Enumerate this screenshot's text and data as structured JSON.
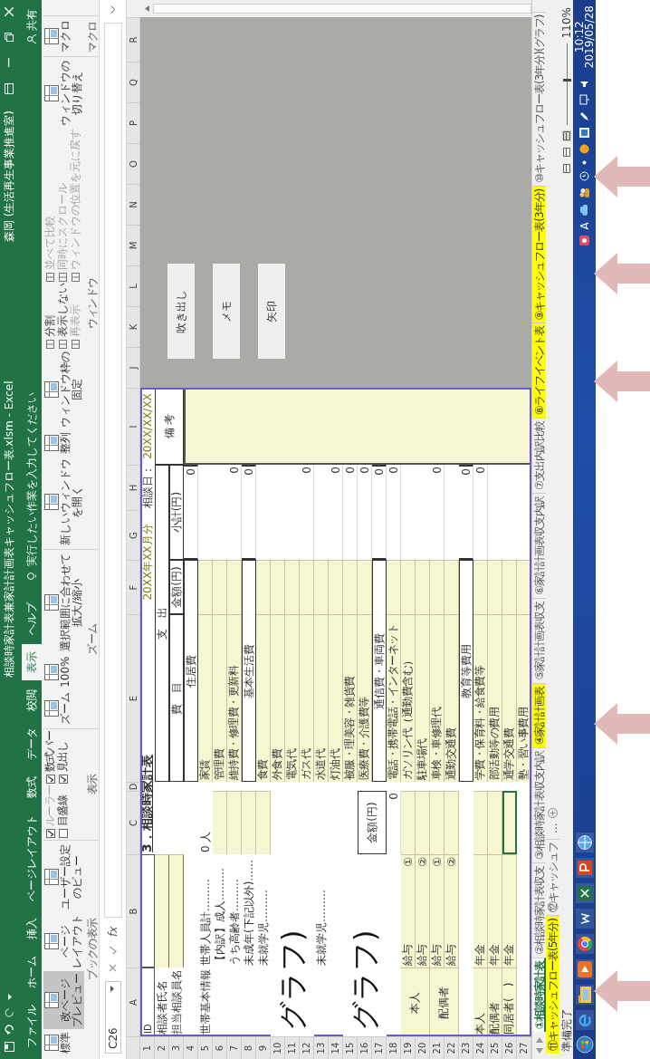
{
  "title_bar": {
    "title": "相談時家計表兼家計計画表キャッシュフロー表.xlsm - Excel",
    "user": "森岡 (生活再生事業推進室)"
  },
  "ribbon_tabs": [
    {
      "label": "ファイル",
      "selected": false
    },
    {
      "label": "ホーム",
      "selected": false
    },
    {
      "label": "挿入",
      "selected": false
    },
    {
      "label": "ページレイアウト",
      "selected": false
    },
    {
      "label": "数式",
      "selected": false
    },
    {
      "label": "データ",
      "selected": false
    },
    {
      "label": "校閲",
      "selected": false
    },
    {
      "label": "表示",
      "selected": true
    },
    {
      "label": "ヘルプ",
      "selected": false
    }
  ],
  "tell_me": {
    "placeholder": "実行したい作業を入力してください"
  },
  "share": "共有",
  "ribbon_groups": [
    {
      "name": "ブックの表示",
      "controls": [
        {
          "kind": "large",
          "lines": [
            "標準"
          ],
          "selected": false
        },
        {
          "kind": "large",
          "lines": [
            "改ページ",
            "プレビュー"
          ],
          "selected": true
        },
        {
          "kind": "large",
          "lines": [
            "ページ",
            "レイアウト"
          ],
          "selected": false
        },
        {
          "kind": "large",
          "lines": [
            "ユーザー設定",
            "のビュー"
          ],
          "selected": false
        }
      ]
    },
    {
      "name": "表示",
      "controls": [
        {
          "kind": "checkbox",
          "label": "ルーラー",
          "checked": true,
          "disabled": true
        },
        {
          "kind": "checkbox",
          "label": "目盛線",
          "checked": false,
          "disabled": false
        },
        {
          "kind": "checkbox",
          "label": "数式バー",
          "checked": true,
          "disabled": false
        },
        {
          "kind": "checkbox",
          "label": "見出し",
          "checked": true,
          "disabled": false
        }
      ]
    },
    {
      "name": "ズーム",
      "controls": [
        {
          "kind": "large",
          "lines": [
            "ズーム"
          ],
          "selected": false
        },
        {
          "kind": "large",
          "lines": [
            "100%"
          ],
          "selected": false
        },
        {
          "kind": "large",
          "lines": [
            "選択範囲に合わせて",
            "拡大/縮小"
          ],
          "selected": false
        }
      ]
    },
    {
      "name": "ウィンドウ",
      "controls": [
        {
          "kind": "large",
          "lines": [
            "新しいウィンドウ",
            "を開く"
          ],
          "selected": false
        },
        {
          "kind": "large",
          "lines": [
            "整列"
          ],
          "selected": false
        },
        {
          "kind": "large",
          "lines": [
            "ウィンドウ枠の",
            "固定"
          ],
          "selected": false
        },
        {
          "kind": "small",
          "label": "分割",
          "disabled": false
        },
        {
          "kind": "small",
          "label": "表示しない",
          "disabled": false
        },
        {
          "kind": "small",
          "label": "再表示",
          "disabled": true
        },
        {
          "kind": "small",
          "label": "並べて比較",
          "disabled": true
        },
        {
          "kind": "small",
          "label": "同時にスクロール",
          "disabled": true
        },
        {
          "kind": "small",
          "label": "ウィンドウの位置を元に戻す",
          "disabled": true
        },
        {
          "kind": "large",
          "lines": [
            "ウィンドウの",
            "切り替え"
          ],
          "selected": false
        }
      ]
    },
    {
      "name": "マクロ",
      "controls": [
        {
          "kind": "large",
          "lines": [
            "マクロ"
          ],
          "selected": false
        }
      ]
    }
  ],
  "formula_bar": {
    "name_box": "C26",
    "fx": "fx"
  },
  "sheet": {
    "columns": [
      "A",
      "B",
      "C",
      "D",
      "E",
      "F",
      "G",
      "H",
      "I",
      "J",
      "K",
      "L",
      "M",
      "N",
      "O",
      "P",
      "Q",
      "R"
    ],
    "rows": [
      "1",
      "2",
      "3",
      "4",
      "5",
      "6",
      "7",
      "8",
      "9",
      "10",
      "11",
      "12",
      "13",
      "14",
      "15",
      "16",
      "17",
      "18",
      "19",
      "20",
      "21",
      "22",
      "23",
      "24",
      "25",
      "26",
      "27"
    ],
    "id_label": "ID",
    "title": "3．相談時家計表",
    "month": "20XX年XX月分",
    "date_label": "相談日：",
    "date": "20XX/XX/XX",
    "client_labels": [
      "相談者氏名",
      "担当相談員名"
    ],
    "household": {
      "heading": "世帯基本情報",
      "total": {
        "label": "世帯人員計………",
        "count": "0 人"
      },
      "lines": [
        {
          "label": "【内訳】成人………"
        },
        {
          "label": "うち高齢者………"
        },
        {
          "label": "未成年(下記以外)……"
        },
        {
          "label": "未就学児………"
        }
      ],
      "lower_lines": [
        {
          "label": "未就学児………"
        }
      ]
    },
    "income": {
      "amount_header": "金額(円)",
      "total": "0",
      "salary": [
        {
          "person": "本人",
          "items": [
            {
              "type": "給与",
              "no": "①"
            },
            {
              "type": "給与",
              "no": "②"
            }
          ]
        },
        {
          "person": "配偶者",
          "items": [
            {
              "type": "給与",
              "no": "①"
            },
            {
              "type": "給与",
              "no": "②"
            }
          ]
        }
      ],
      "pension": [
        {
          "person": "本人",
          "type": "年金",
          "selected": false
        },
        {
          "person": "配偶者",
          "type": "年金",
          "selected": false
        },
        {
          "person": "同居者(　)",
          "type": "年金",
          "selected": true
        }
      ]
    },
    "expense": {
      "header": "支　出",
      "col_item": "費　目",
      "col_amount": "金額(円)",
      "col_subtotal": "小計(円)",
      "groups": [
        {
          "name": "住居費",
          "subtotal": "0",
          "items": [
            {
              "name": "家賃"
            },
            {
              "name": "管理費"
            },
            {
              "name": "維持費・修理費・更新料",
              "subtotal": "0"
            }
          ]
        },
        {
          "name": "基本生活費",
          "subtotal": "0",
          "items": [
            {
              "name": "食費"
            },
            {
              "name": "外食費"
            },
            {
              "name": "電気代"
            },
            {
              "name": "ガス代",
              "subtotal": "0"
            },
            {
              "name": "水道代"
            },
            {
              "name": "灯油代",
              "subtotal": "0"
            },
            {
              "name": "被服・理美容・雑貨費",
              "subtotal": "0"
            },
            {
              "name": "医療費・介護費等",
              "subtotal": "0"
            }
          ]
        },
        {
          "name": "通信費・車両費",
          "subtotal": "0",
          "items": [
            {
              "name": "電話・携帯電話・インターネット",
              "subtotal": "0"
            },
            {
              "name": "ガソリン代（通勤費含む）"
            },
            {
              "name": "駐車場代"
            },
            {
              "name": "車検・車修理代",
              "subtotal": "0"
            },
            {
              "name": "通勤交通費"
            }
          ]
        },
        {
          "name": "教育等費用",
          "subtotal": "0",
          "items": [
            {
              "name": "学費・保育料・給食費等",
              "subtotal": "0"
            },
            {
              "name": "部活動等の費用"
            },
            {
              "name": "通学交通費"
            },
            {
              "name": "塾・習い事費用"
            }
          ]
        }
      ]
    },
    "remarks_header": "備 考",
    "shape_buttons": [
      "吹き出し",
      "メモ",
      "矢印"
    ],
    "overlays": [
      "グラフ)",
      "グラフ)"
    ]
  },
  "sheet_tabs": [
    {
      "label": "①相談時家計表",
      "selected": true,
      "highlighted": false
    },
    {
      "label": "②相談時家計表収支",
      "selected": false,
      "highlighted": false
    },
    {
      "label": "③相談時家計表収支内訳",
      "selected": false,
      "highlighted": false
    },
    {
      "label": "④家計計画表",
      "selected": false,
      "highlighted": true
    },
    {
      "label": "⑤家計計画表収支",
      "selected": false,
      "highlighted": false
    },
    {
      "label": "⑥家計計画表収支内訳",
      "selected": false,
      "highlighted": false
    },
    {
      "label": "⑦支出内訳比較",
      "selected": false,
      "highlighted": false
    },
    {
      "label": "⑧ライフイベント表",
      "selected": false,
      "highlighted": true
    },
    {
      "label": "⑨キャッシュフロー表(3年分)",
      "selected": false,
      "highlighted": true
    },
    {
      "label": "⑩キャッシュフロー表(3年分)(グラフ)",
      "selected": false,
      "highlighted": false
    },
    {
      "label": "⑪キャッシュフロー表(5年分)",
      "selected": false,
      "highlighted": true
    },
    {
      "label": "⑫キャッシュフ",
      "selected": false,
      "highlighted": false
    }
  ],
  "more_tabs": "...",
  "status_bar": {
    "status": "準備完了",
    "view_buttons": [
      {
        "selected": false
      },
      {
        "selected": false
      },
      {
        "selected": true
      }
    ],
    "zoom_slider": {
      "level": 0.55
    },
    "zoom": "110%"
  },
  "taskbar": {
    "apps": [
      {
        "kind": "ie"
      },
      {
        "kind": "explorer"
      },
      {
        "kind": "media"
      },
      {
        "kind": "chrome"
      },
      {
        "kind": "word"
      },
      {
        "kind": "excel"
      },
      {
        "kind": "powerpoint"
      },
      {
        "kind": "globe"
      }
    ],
    "tray": [
      {
        "kind": "red"
      },
      {
        "kind": "ime"
      },
      {
        "kind": "cloud"
      },
      {
        "kind": "people"
      },
      {
        "kind": "circle"
      },
      {
        "kind": "dot"
      },
      {
        "kind": "orange"
      },
      {
        "kind": "picture"
      },
      {
        "kind": "pen"
      },
      {
        "kind": "monitor"
      },
      {
        "kind": "speaker"
      }
    ],
    "ime": "A",
    "time": "10:12",
    "date": "2019/05/28"
  }
}
